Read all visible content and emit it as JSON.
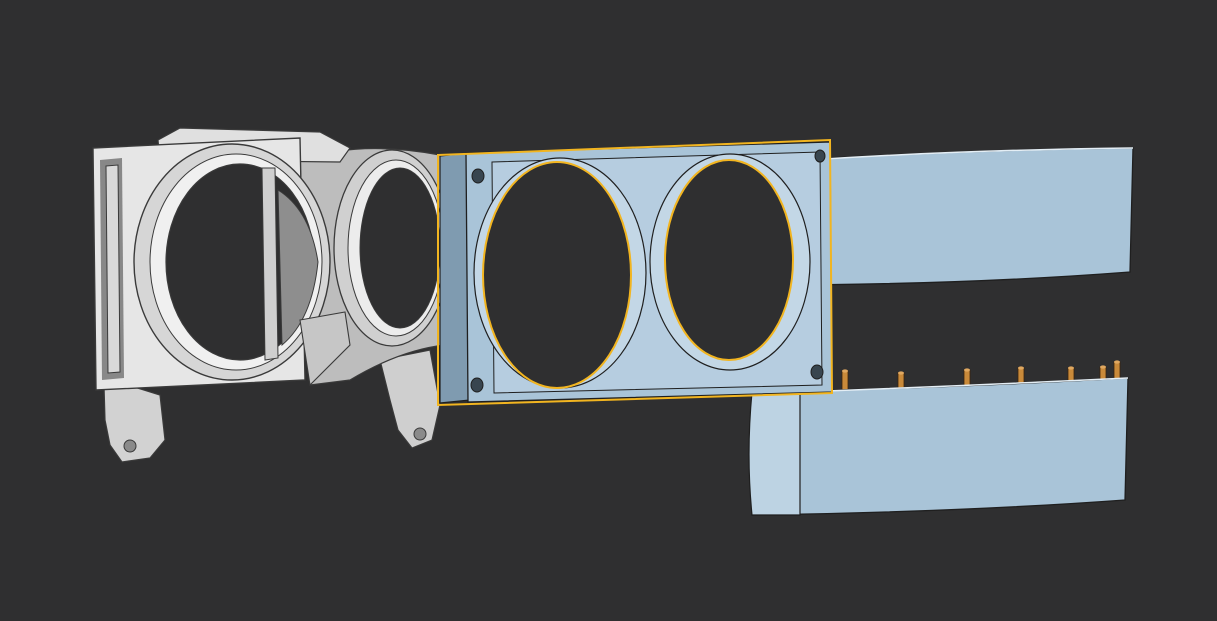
{
  "viewport": {
    "background": "#2f2f30"
  },
  "colors": {
    "grey_part_light": "#e6e6e6",
    "grey_part_mid": "#c9c9c9",
    "grey_part_dark": "#9b9b9b",
    "edge_dark": "#3a3a3a",
    "blue_part": "#a9c4d8",
    "blue_part_light": "#c3d7e6",
    "blue_part_dark": "#7f9bb0",
    "selection_outline": "#f2b520",
    "pin_copper": "#c98a3a"
  },
  "parts": {
    "fan_duct_shroud": {
      "selected": false,
      "color_role": "grey"
    },
    "fan_mount_frame": {
      "selected": true,
      "color_role": "blue"
    },
    "upper_curved_plate": {
      "selected": false,
      "color_role": "blue"
    },
    "lower_curved_plate": {
      "selected": false,
      "color_role": "blue"
    },
    "pin_row_count": 7
  }
}
